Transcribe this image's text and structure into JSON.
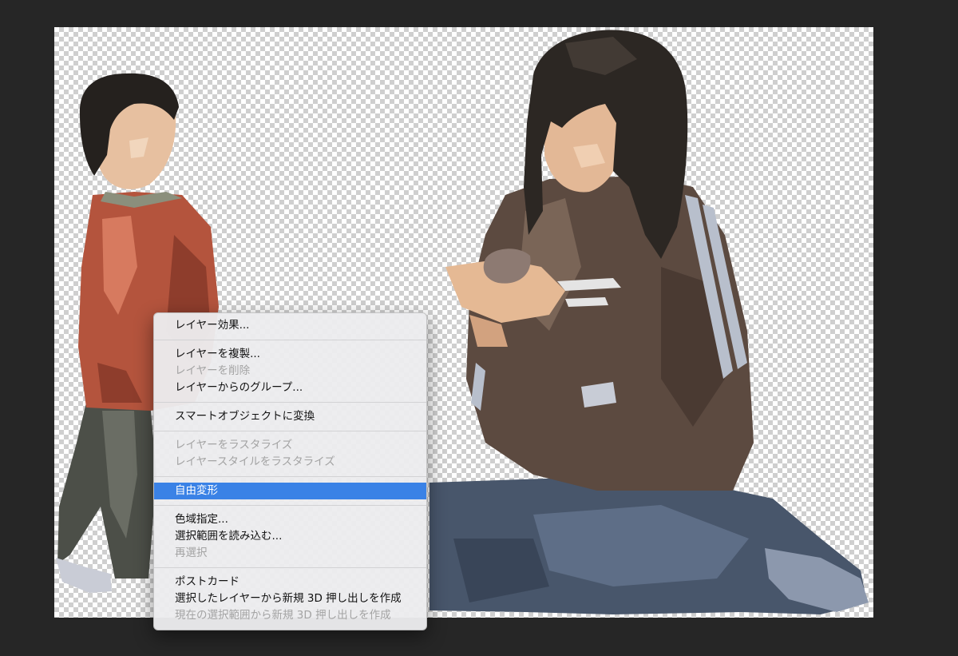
{
  "colors": {
    "workspace": "#262626",
    "menu_background": "#ececee",
    "selection": "#3a82e6",
    "disabled_text": "#a3a3a3"
  },
  "context_menu": {
    "groups": [
      {
        "items": [
          {
            "label": "レイヤー効果...",
            "enabled": true
          }
        ]
      },
      {
        "items": [
          {
            "label": "レイヤーを複製...",
            "enabled": true
          },
          {
            "label": "レイヤーを削除",
            "enabled": false
          },
          {
            "label": "レイヤーからのグループ...",
            "enabled": true
          }
        ]
      },
      {
        "items": [
          {
            "label": "スマートオブジェクトに変換",
            "enabled": true
          }
        ]
      },
      {
        "items": [
          {
            "label": "レイヤーをラスタライズ",
            "enabled": false
          },
          {
            "label": "レイヤースタイルをラスタライズ",
            "enabled": false
          }
        ]
      },
      {
        "items": [
          {
            "label": "自由変形",
            "enabled": true,
            "selected": true
          }
        ]
      },
      {
        "items": [
          {
            "label": "色域指定...",
            "enabled": true
          },
          {
            "label": "選択範囲を読み込む...",
            "enabled": true
          },
          {
            "label": "再選択",
            "enabled": false
          }
        ]
      },
      {
        "items": [
          {
            "label": "ポストカード",
            "enabled": true
          },
          {
            "label": "選択したレイヤーから新規 3D 押し出しを作成",
            "enabled": true
          },
          {
            "label": "現在の選択範囲から新規 3D 押し出しを作成",
            "enabled": false
          }
        ]
      }
    ]
  }
}
